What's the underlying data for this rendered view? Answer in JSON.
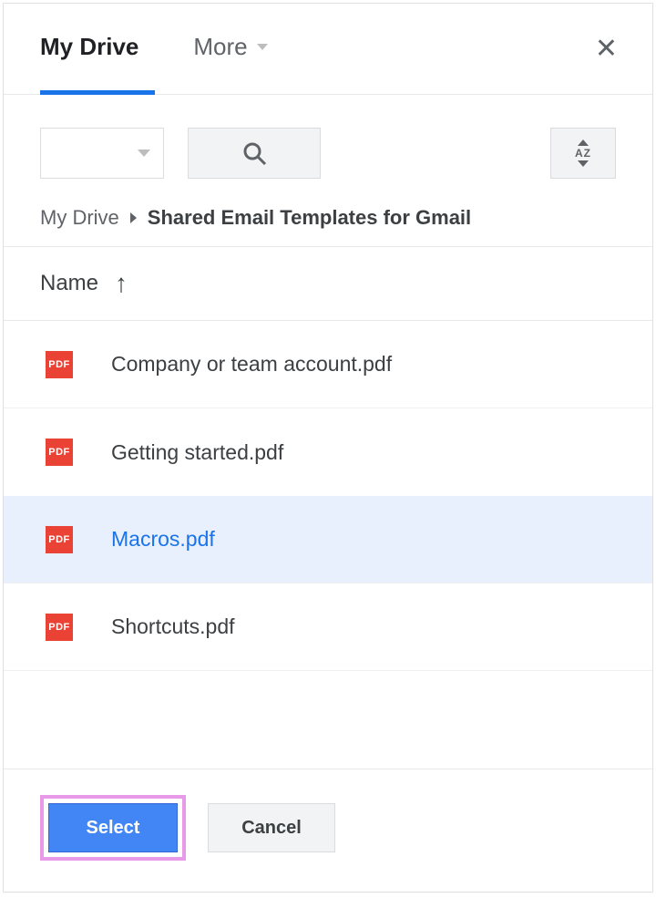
{
  "tabs": {
    "my_drive": "My Drive",
    "more": "More"
  },
  "breadcrumb": {
    "root": "My Drive",
    "current": "Shared Email Templates for Gmail"
  },
  "column_header": "Name",
  "files": [
    {
      "name": "Company or team account.pdf",
      "icon": "PDF",
      "selected": false
    },
    {
      "name": "Getting started.pdf",
      "icon": "PDF",
      "selected": false
    },
    {
      "name": "Macros.pdf",
      "icon": "PDF",
      "selected": true
    },
    {
      "name": "Shortcuts.pdf",
      "icon": "PDF",
      "selected": false
    }
  ],
  "footer": {
    "select": "Select",
    "cancel": "Cancel"
  },
  "sort_label": "AZ"
}
